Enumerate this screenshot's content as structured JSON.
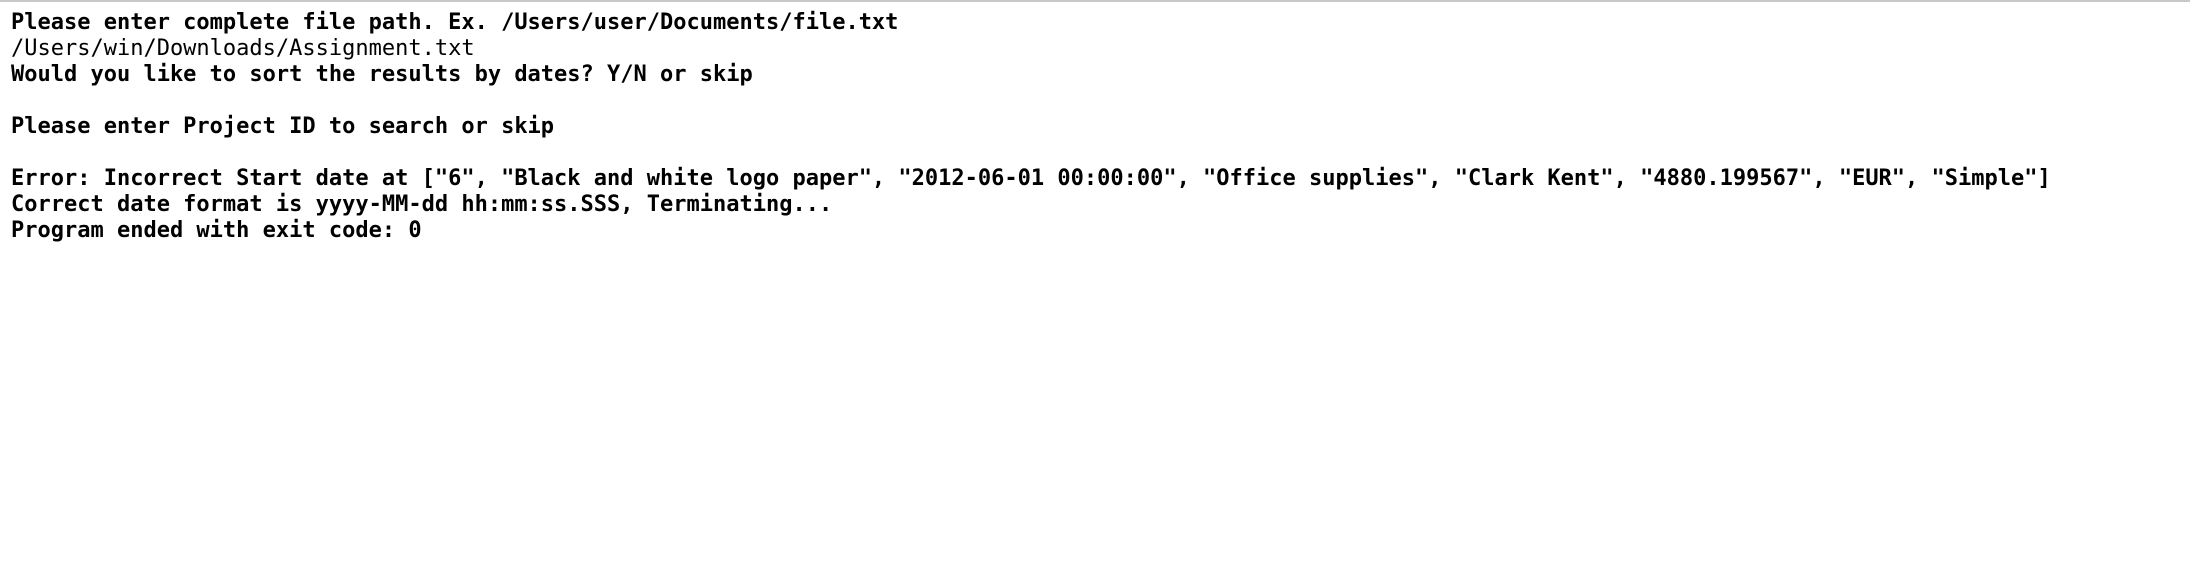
{
  "console": {
    "lines": [
      {
        "text": "Please enter complete file path. Ex. /Users/user/Documents/file.txt",
        "bold": true
      },
      {
        "text": "/Users/win/Downloads/Assignment.txt",
        "bold": false
      },
      {
        "text": "Would you like to sort the results by dates? Y/N or skip",
        "bold": true
      },
      {
        "text": "",
        "bold": false
      },
      {
        "text": "Please enter Project ID to search or skip",
        "bold": true
      },
      {
        "text": "",
        "bold": false
      },
      {
        "text": "Error: Incorrect Start date at [\"6\", \"Black and white logo paper\", \"2012-06-01 00:00:00\", \"Office supplies\", \"Clark Kent\", \"4880.199567\", \"EUR\", \"Simple\"]",
        "bold": true
      },
      {
        "text": "Correct date format is yyyy-MM-dd hh:mm:ss.SSS, Terminating...",
        "bold": true
      },
      {
        "text": "Program ended with exit code: 0",
        "bold": true
      }
    ]
  }
}
